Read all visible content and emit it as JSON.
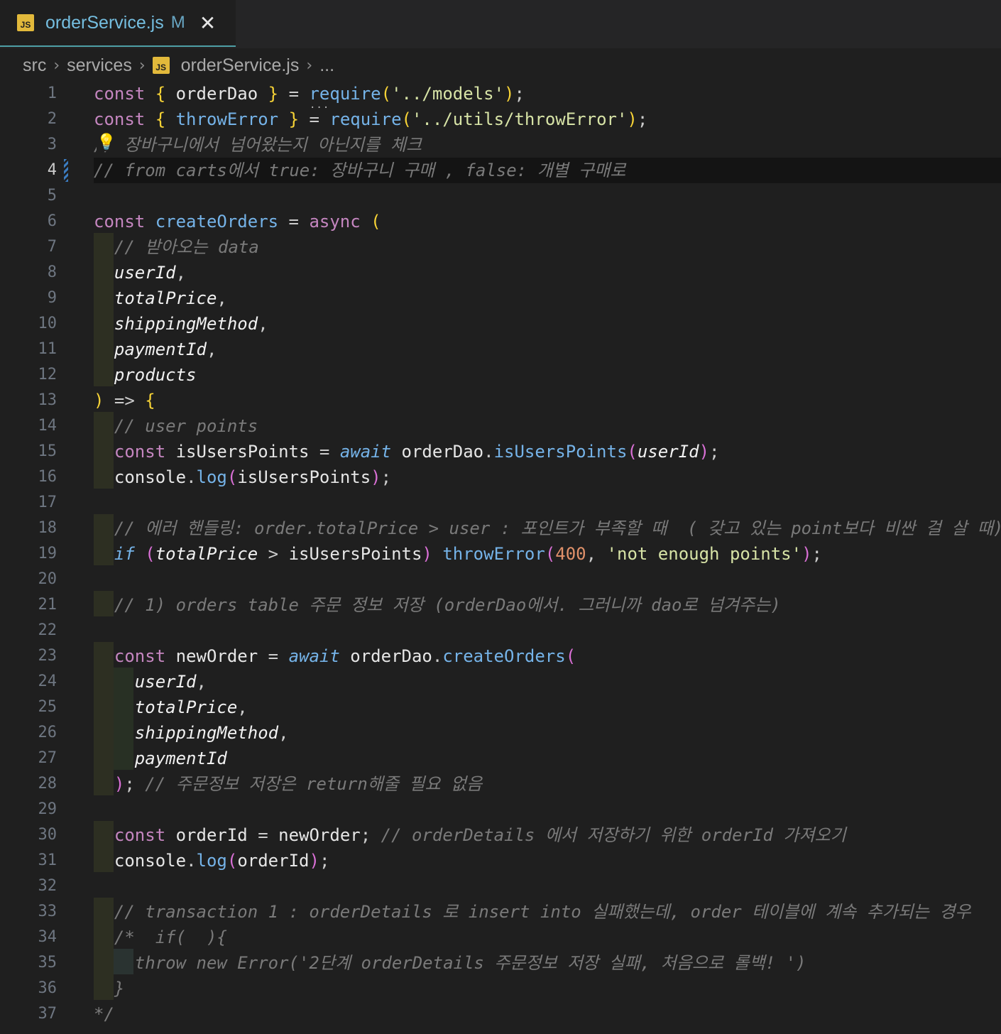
{
  "tab": {
    "icon": "JS",
    "title": "orderService.js",
    "modified": "M",
    "close": "✕"
  },
  "breadcrumb": {
    "parts": [
      "src",
      "services"
    ],
    "file_icon": "JS",
    "file": "orderService.js",
    "more": "...",
    "separator": "›"
  },
  "colors": {
    "accent_border": "#4ea0a6",
    "keyword": "#c586c0",
    "string": "#ce9178",
    "comment": "#7a7a7a",
    "function": "#75b3e8",
    "bracket_yellow": "#f7d336",
    "bracket_pink": "#da70d6"
  },
  "icons": {
    "tab_file": "javascript-file-icon",
    "lightbulb": "lightbulb-icon",
    "close": "close-icon"
  },
  "lines": [
    "const { orderDao } = require('../models');",
    "const { throwError } = require('../utils/throwError');",
    "// 장바구니에서 넘어왔는지 아닌지를 체크",
    "// from carts에서 true: 장바구니 구매 , false: 개별 구매로",
    "",
    "const createOrders = async (",
    "  // 받아오는 data",
    "  userId,",
    "  totalPrice,",
    "  shippingMethod,",
    "  paymentId,",
    "  products",
    ") => {",
    "  // user points",
    "  const isUsersPoints = await orderDao.isUsersPoints(userId);",
    "  console.log(isUsersPoints);",
    "",
    "  // 에러 핸들링: order.totalPrice > user : 포인트가 부족할 때  ( 갖고 있는 point보다 비싼 걸 살 때)",
    "  if (totalPrice > isUsersPoints) throwError(400, 'not enough points');",
    "",
    "  // 1) orders table 주문 정보 저장 (orderDao에서. 그러니까 dao로 넘겨주는)",
    "",
    "  const newOrder = await orderDao.createOrders(",
    "    userId,",
    "    totalPrice,",
    "    shippingMethod,",
    "    paymentId",
    "  ); // 주문정보 저장은 return해줄 필요 없음",
    "",
    "  const orderId = newOrder; // orderDetails 에서 저장하기 위한 orderId 가져오기",
    "  console.log(orderId);",
    "",
    "  // transaction 1 : orderDetails 로 insert into 실패했는데, order 테이블에 계속 추가되는 경우",
    "  /*  if(  ){",
    "    throw new Error('2단계 orderDetails 주문정보 저장 실패, 처음으로 롤백! ')",
    "  }",
    "*/"
  ],
  "line_numbers": [
    "1",
    "2",
    "3",
    "4",
    "5",
    "6",
    "7",
    "8",
    "9",
    "10",
    "11",
    "12",
    "13",
    "14",
    "15",
    "16",
    "17",
    "18",
    "19",
    "20",
    "21",
    "22",
    "23",
    "24",
    "25",
    "26",
    "27",
    "28",
    "29",
    "30",
    "31",
    "32",
    "33",
    "34",
    "35",
    "36",
    "37"
  ],
  "active_line": "4"
}
